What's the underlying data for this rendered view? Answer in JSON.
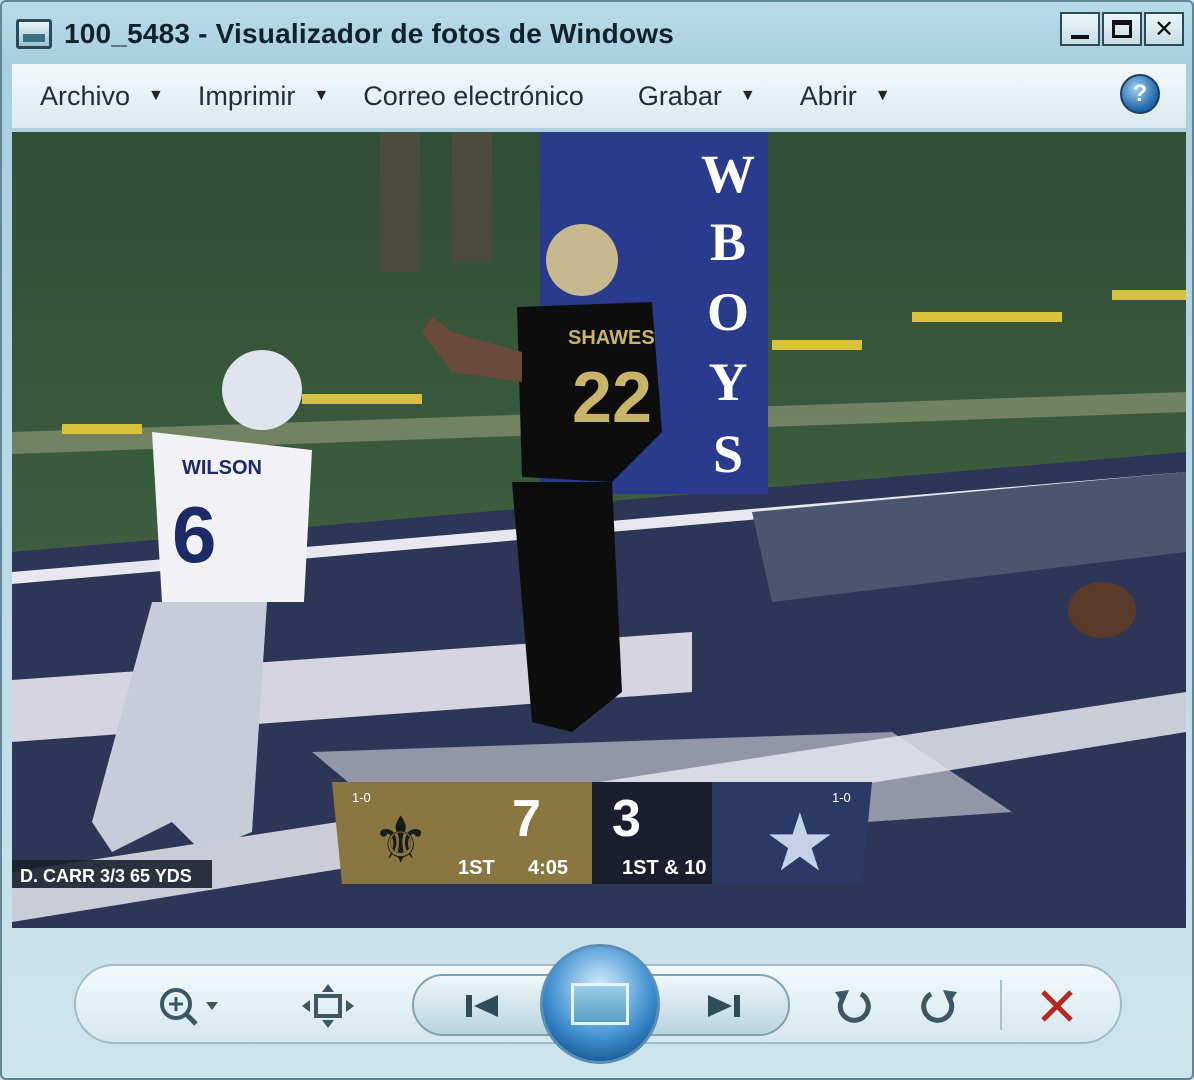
{
  "window": {
    "title": "100_5483 - Visualizador de fotos de Windows",
    "controls": {
      "minimize": "_",
      "maximize": "□",
      "close": "✕"
    }
  },
  "menu": {
    "items": [
      {
        "label": "Archivo",
        "has_arrow": true
      },
      {
        "label": "Imprimir",
        "has_arrow": true
      },
      {
        "label": "Correo electrónico",
        "has_arrow": false
      },
      {
        "label": "Grabar",
        "has_arrow": true
      },
      {
        "label": "Abrir",
        "has_arrow": true
      }
    ],
    "arrow_glyph": "▼",
    "help_label": "?"
  },
  "photo": {
    "player_left_name": "WILSON",
    "player_left_number": "6",
    "player_right_name": "SHAWES",
    "player_right_number": "22",
    "pylon_text": [
      "W",
      "B",
      "O",
      "Y",
      "S"
    ],
    "scoreboard": {
      "left_record": "1-0",
      "right_record": "1-0",
      "home_score": "7",
      "away_score": "3",
      "quarter": "1ST",
      "clock": "4:05",
      "down": "1ST & 10"
    },
    "caption": "D. CARR 3/3  65 YDS"
  },
  "toolbar": {
    "icons": [
      "zoom-icon",
      "actual-size-icon",
      "previous-icon",
      "slideshow-icon",
      "next-icon",
      "rotate-ccw-icon",
      "rotate-cw-icon",
      "delete-icon"
    ],
    "delete_color": "#b5281f"
  }
}
